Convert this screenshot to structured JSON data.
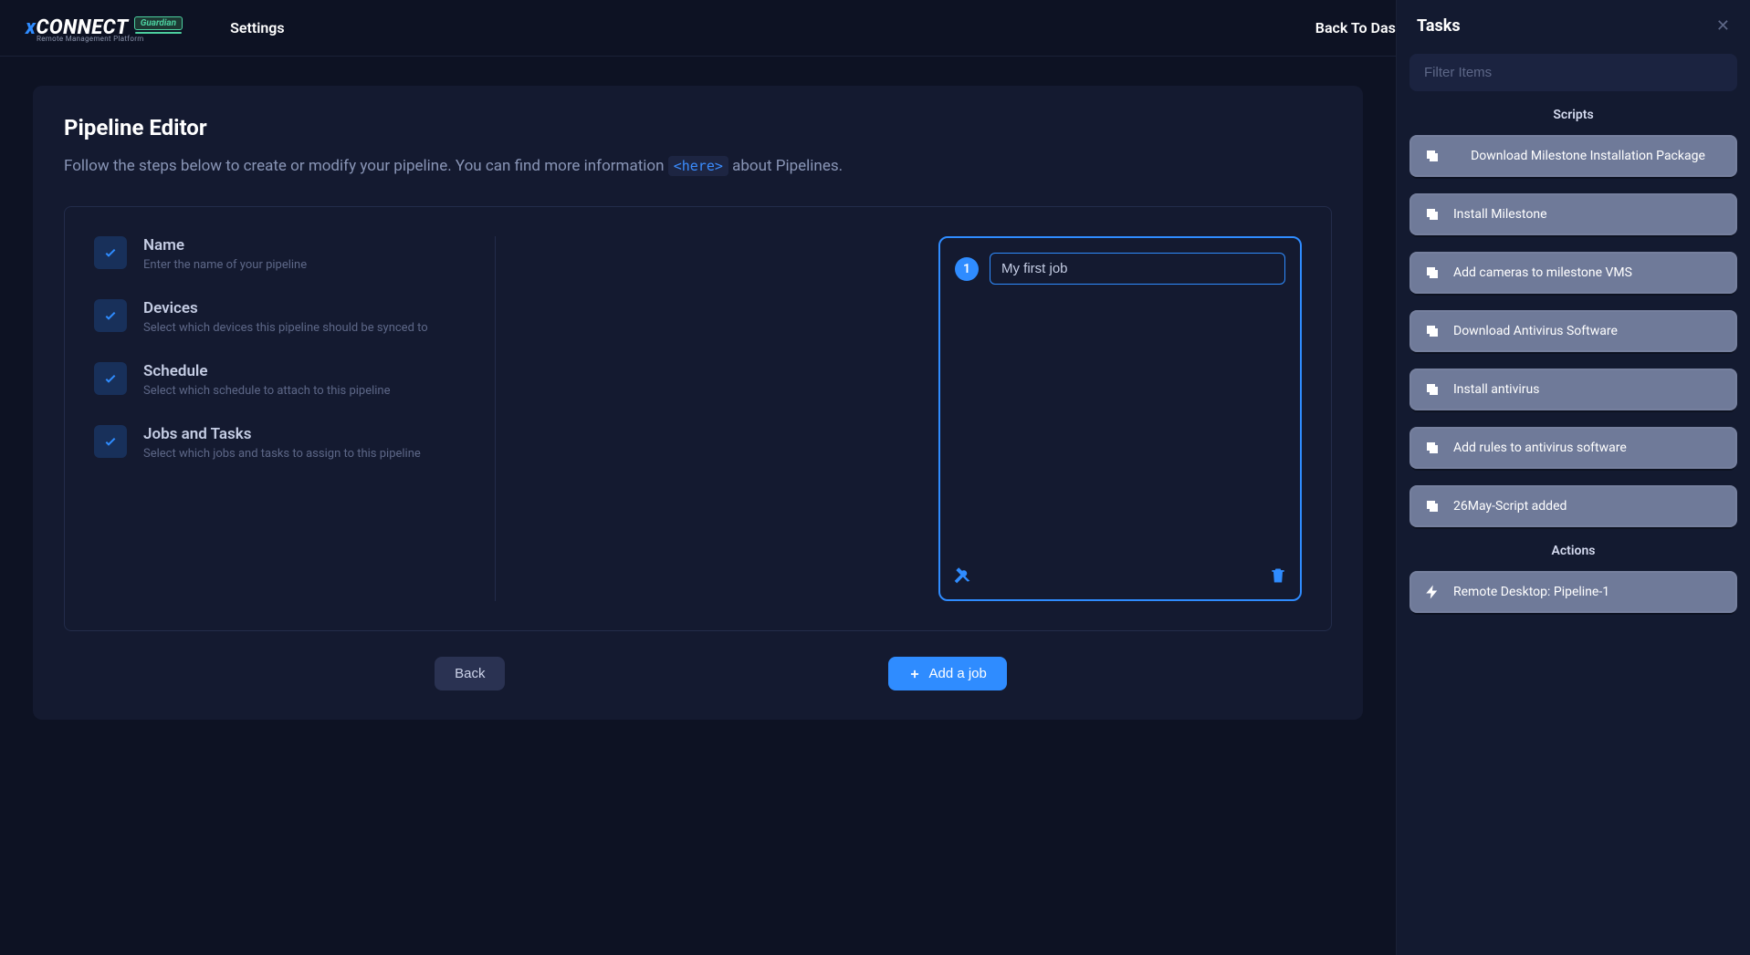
{
  "header": {
    "brand_x": "x",
    "brand_main": "CONNECT",
    "brand_badge": "Guardian",
    "brand_sub": "Remote Management Platform",
    "nav_settings": "Settings",
    "back_link": "Back To Dashboard"
  },
  "page": {
    "title": "Pipeline Editor",
    "desc_before": "Follow the steps below to create or modify your pipeline. You can find more information ",
    "desc_here": "<here>",
    "desc_after": " about Pipelines."
  },
  "steps": [
    {
      "title": "Name",
      "desc": "Enter the name of your pipeline"
    },
    {
      "title": "Devices",
      "desc": "Select which devices this pipeline should be synced to"
    },
    {
      "title": "Schedule",
      "desc": "Select which schedule to attach to this pipeline"
    },
    {
      "title": "Jobs and Tasks",
      "desc": "Select which jobs and tasks to assign to this pipeline"
    }
  ],
  "job": {
    "number": "1",
    "name_value": "My first job"
  },
  "buttons": {
    "back": "Back",
    "add_job": "Add a job"
  },
  "tasks_panel": {
    "title": "Tasks",
    "filter_placeholder": "Filter Items",
    "section_scripts": "Scripts",
    "section_actions": "Actions",
    "scripts": [
      "Download Milestone Installation Package",
      "Install Milestone",
      "Add cameras to milestone VMS",
      "Download Antivirus Software",
      "Install antivirus",
      "Add rules to antivirus software",
      "26May-Script added"
    ],
    "actions": [
      "Remote Desktop: Pipeline-1"
    ]
  }
}
